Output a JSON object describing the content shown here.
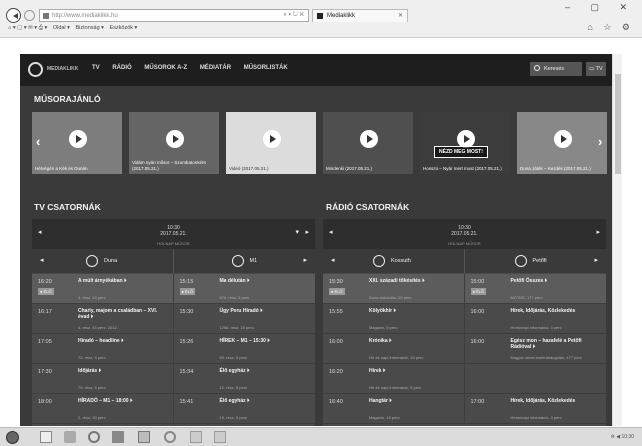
{
  "browser": {
    "address": "http://www.mediaklikk.hu",
    "tab_title": "Mediaklikk",
    "window_controls": "– ▢ ✕",
    "home_icons": "⌂ ☆ ⚙",
    "toolbar_items": [
      "Oldal ▾",
      "Biztonság ▾",
      "Eszközök ▾"
    ]
  },
  "site": {
    "logo": "MEDIAKLIKK",
    "nav": [
      "TV",
      "RÁDIÓ",
      "MŰSOROK A-Z",
      "MÉDIATÁR",
      "MŰSORLISTÁK"
    ],
    "search_label": "Keresés",
    "tv_label": "TV"
  },
  "recommendations": {
    "title": "MŰSORAJÁNLÓ",
    "items": [
      {
        "caption": "Hétvégén a Kék és Dunán",
        "bg": "#7d7d7d"
      },
      {
        "caption": "Vidám nyári műsor – Szombatonként (2017.05.21.)",
        "bg": "#656565"
      },
      {
        "caption": "Videó (2017.05.21.)",
        "bg": "#dcdcdc",
        "light": true
      },
      {
        "caption": "Mindenki (2017.05.21.)",
        "bg": "#4f4f4f"
      },
      {
        "caption": "Hosszú – Nyár mert most (2017.05.21.)",
        "bg": "#3c3c3c",
        "cta": "NÉZD MEG MOST!"
      },
      {
        "caption": "Duna Játék – Kezdés (2017.05.21.)",
        "bg": "#888888"
      }
    ]
  },
  "tv": {
    "title": "TV CSATORNÁK",
    "time": "10:30",
    "date": "2017.05.21.",
    "now_label": "HOLNAP MŰSOR",
    "channels": [
      "Duna",
      "M1"
    ],
    "rows": [
      [
        {
          "time": "16:20",
          "live": true,
          "title": "A múlt árnyékában ⏵",
          "meta": "4. rész, 45 perc"
        },
        {
          "time": "15:15",
          "live": true,
          "title": "Ma délután ⏵",
          "meta": "876. rész, 5 perc"
        }
      ],
      [
        {
          "time": "16:17",
          "title": "Charly, majom a családban – XVI. évad ⏵",
          "meta": "4. rész, 45 perc, 2012."
        },
        {
          "time": "15:30",
          "title": "Ügy Peru Híradó ⏵",
          "meta": "1266. rész, 15 perc"
        }
      ],
      [
        {
          "time": "17:05",
          "title": "Híradó – headline ⏵",
          "meta": "72. rész, 3 perc"
        },
        {
          "time": "15:26",
          "title": "HÍREK – M1 – 15:30 ⏵",
          "meta": "60. rész, 5 perc"
        }
      ],
      [
        {
          "time": "17:30",
          "title": "Időjárás ⏵",
          "meta": "70. rész, 5 perc"
        },
        {
          "time": "15:34",
          "title": "Élő egyház ⏵",
          "meta": "12. rész, 5 perc"
        }
      ],
      [
        {
          "time": "18:00",
          "title": "HÍRADÓ – M1 – 18:00 ⏵",
          "meta": "2. rész, 30 perc"
        },
        {
          "time": "15:41",
          "title": "Élő egyház ⏵",
          "meta": "19. rész, 5 perc"
        }
      ]
    ]
  },
  "radio": {
    "title": "RÁDIÓ CSATORNÁK",
    "time": "10:30",
    "date": "2017.05.21.",
    "now_label": "HOLNAP MŰSOR",
    "channels": [
      "Kossuth",
      "Petőfi"
    ],
    "rows": [
      [
        {
          "time": "15:30",
          "live": true,
          "title": "XXI. századi tőkésítés ⏵",
          "meta": "Duna tudósítás, 25 perc"
        },
        {
          "time": "15:00",
          "live": true,
          "title": "Petőfi Összes ⏵",
          "meta": "MÓTKÉ, 177 perc"
        }
      ],
      [
        {
          "time": "15:55",
          "title": "Kölyökhír ⏵",
          "meta": "Magazin, 5 perc"
        },
        {
          "time": "16:00",
          "title": "Hírek, Időjárás, Közlekedés",
          "meta": "Hírek/napi információ, 3 perc"
        }
      ],
      [
        {
          "time": "16:00",
          "title": "Krónika ⏵",
          "meta": "Hír és napi információ, 15 perc"
        },
        {
          "time": "16:00",
          "title": "Egész mon – hazafelé a Petőfi Rádióval ⏵",
          "meta": "Magyar zenei eset/ráhangolás, 177 perc"
        }
      ],
      [
        {
          "time": "16:20",
          "title": "Hírek ⏵",
          "meta": "Hír és napi információ, 5 perc"
        },
        {
          "time": "",
          "title": "",
          "meta": ""
        }
      ],
      [
        {
          "time": "16:40",
          "title": "Hangtár ⏵",
          "meta": "Magazin, 15 perc"
        },
        {
          "time": "17:00",
          "title": "Hírek, Időjárás, Közlekedés",
          "meta": "Hírek/napi információ, 3 perc"
        }
      ]
    ]
  },
  "taskbar": {
    "tray": "⟰ ◀ 10:30"
  }
}
